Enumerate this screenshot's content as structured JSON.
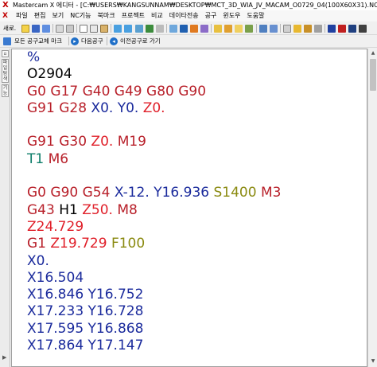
{
  "window": {
    "title": "Mastercam X 에디터 - [C:₩USERS₩KANGSUNNAM₩DESKTOP₩MCT_3D_WIA_JV_MACAM_O0729_04(100X60X31).NC]",
    "app_icon_glyph": "X",
    "app_icon_color": "#c00000"
  },
  "menu": {
    "items": [
      "파일",
      "편집",
      "보기",
      "NC기능",
      "북마크",
      "프로젝트",
      "비교",
      "데이타전송",
      "공구",
      "윈도우",
      "도움말"
    ]
  },
  "toolbar": {
    "new_label": "새로.",
    "all_tools_label": "모든 공구교체 마크",
    "next_tool_label": "다음공구",
    "prev_tool_label": "이전공구로 가기"
  },
  "sidepanel": {
    "tabs": [
      "파",
      "일",
      "탐",
      "색",
      "기",
      "능"
    ]
  },
  "colors": {
    "black": "#000000",
    "red": "#b8202a",
    "blue": "#1a2a9c",
    "teal": "#0e7e6a",
    "olive": "#8a8a10",
    "brightred": "#e0202a"
  },
  "code": {
    "lines": [
      [
        {
          "t": "%",
          "c": "blue"
        }
      ],
      [
        {
          "t": "O2904",
          "c": "black"
        }
      ],
      [
        {
          "t": "G0 G17 G40 G49 G80 G90",
          "c": "red"
        }
      ],
      [
        {
          "t": "G91 G28 ",
          "c": "red"
        },
        {
          "t": "X0.",
          "c": "blue"
        },
        {
          "t": " ",
          "c": "black"
        },
        {
          "t": "Y0.",
          "c": "blue"
        },
        {
          "t": " ",
          "c": "black"
        },
        {
          "t": "Z0.",
          "c": "brightred"
        }
      ],
      [
        {
          "t": "",
          "c": "black"
        }
      ],
      [
        {
          "t": "G91 G30 ",
          "c": "red"
        },
        {
          "t": "Z0.",
          "c": "brightred"
        },
        {
          "t": " M19",
          "c": "red"
        }
      ],
      [
        {
          "t": "T1",
          "c": "teal"
        },
        {
          "t": " M6",
          "c": "red"
        }
      ],
      [
        {
          "t": "",
          "c": "black"
        }
      ],
      [
        {
          "t": "G0 G90 G54 ",
          "c": "red"
        },
        {
          "t": "X-12.",
          "c": "blue"
        },
        {
          "t": " ",
          "c": "black"
        },
        {
          "t": "Y16.936",
          "c": "blue"
        },
        {
          "t": " ",
          "c": "black"
        },
        {
          "t": "S1400",
          "c": "olive"
        },
        {
          "t": " M3",
          "c": "red"
        }
      ],
      [
        {
          "t": "G43 ",
          "c": "red"
        },
        {
          "t": "H1",
          "c": "black"
        },
        {
          "t": " ",
          "c": "black"
        },
        {
          "t": "Z50.",
          "c": "brightred"
        },
        {
          "t": " M8",
          "c": "red"
        }
      ],
      [
        {
          "t": "Z24.729",
          "c": "brightred"
        }
      ],
      [
        {
          "t": "G1 ",
          "c": "red"
        },
        {
          "t": "Z19.729",
          "c": "brightred"
        },
        {
          "t": " ",
          "c": "black"
        },
        {
          "t": "F100",
          "c": "olive"
        }
      ],
      [
        {
          "t": "X0.",
          "c": "blue"
        }
      ],
      [
        {
          "t": "X16.504",
          "c": "blue"
        }
      ],
      [
        {
          "t": "X16.846 Y16.752",
          "c": "blue"
        }
      ],
      [
        {
          "t": "X17.233 Y16.728",
          "c": "blue"
        }
      ],
      [
        {
          "t": "X17.595 Y16.868",
          "c": "blue"
        }
      ],
      [
        {
          "t": "X17.864 Y17.147",
          "c": "blue"
        }
      ]
    ]
  }
}
